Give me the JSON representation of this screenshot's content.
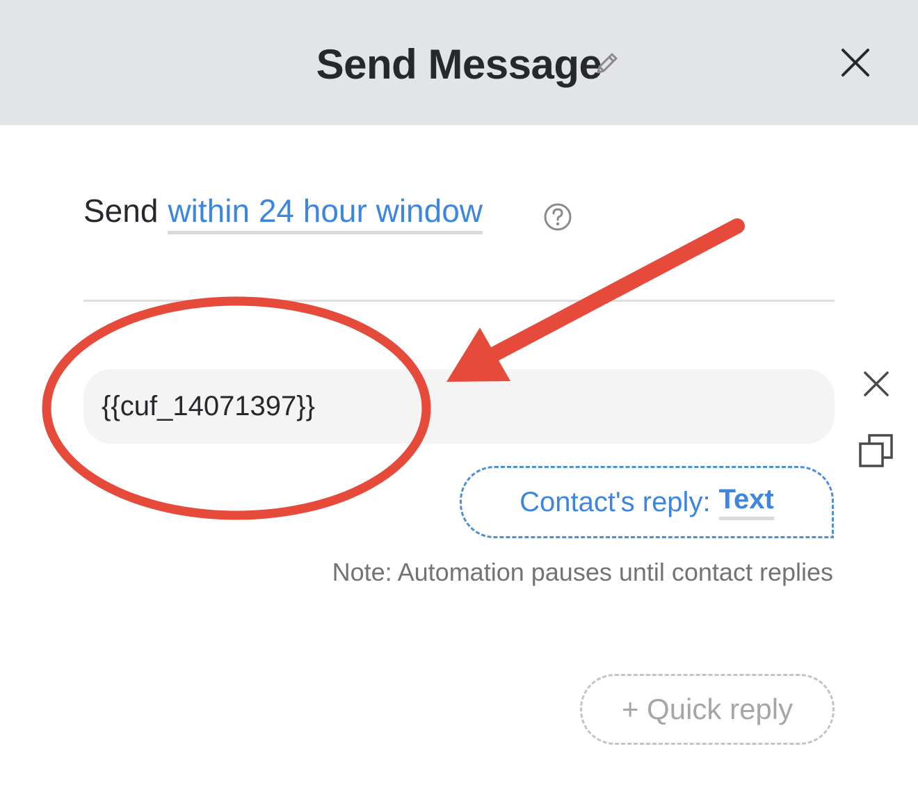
{
  "header": {
    "title": "Send Message",
    "edit_icon": "pencil-icon",
    "close_icon": "close-icon"
  },
  "send_window": {
    "prefix": "Send",
    "link_label": "within 24 hour window",
    "help_icon": "question-circle-icon"
  },
  "message": {
    "text": "{{cuf_14071397}}",
    "delete_icon": "close-icon",
    "duplicate_icon": "copy-icon"
  },
  "reply": {
    "prefix": "Contact's reply:",
    "type": "Text"
  },
  "note": "Note: Automation pauses until contact replies",
  "quick_reply": {
    "label": "+ Quick reply"
  },
  "colors": {
    "header_bg": "#e2e4e8",
    "accent_blue": "#3d86e0",
    "annotation_red": "#e64a3b"
  }
}
